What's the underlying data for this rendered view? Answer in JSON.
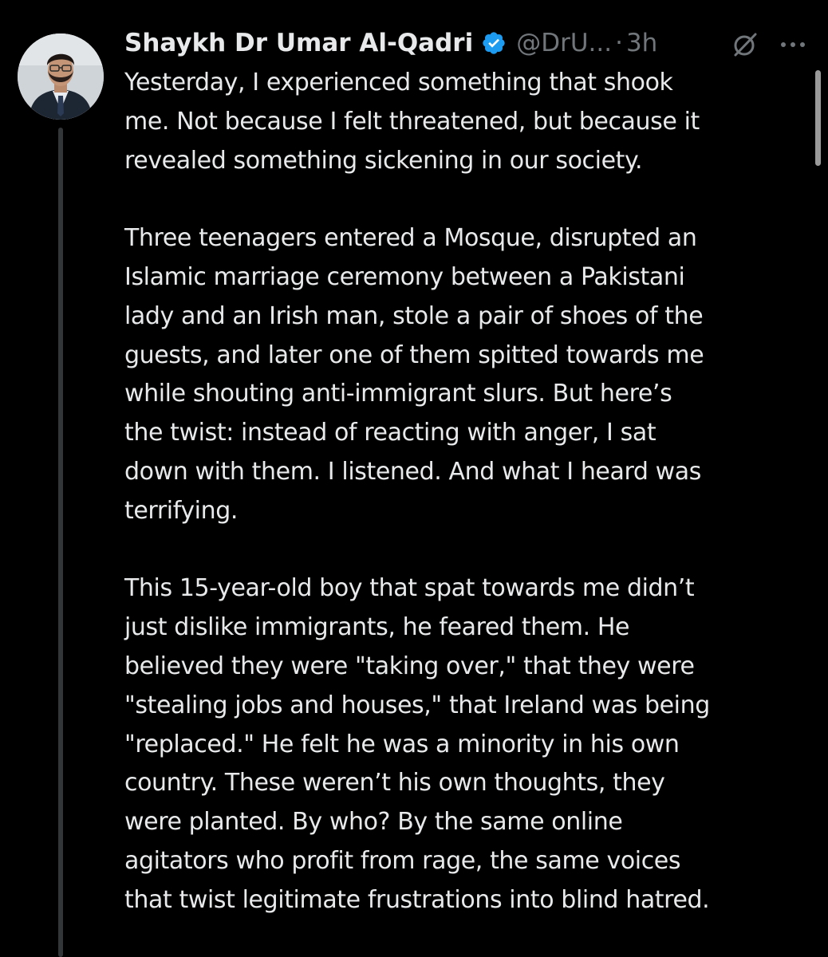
{
  "author": {
    "display_name": "Shaykh Dr Umar Al-Qadri",
    "handle": "@DrU...",
    "separator": "·",
    "time": "3h"
  },
  "icons": {
    "verified": "verified-badge-icon",
    "grok": "grok-icon",
    "more": "more-options-icon"
  },
  "colors": {
    "background": "#000000",
    "text": "#e7e9ea",
    "secondary_text": "#71767b",
    "verified_blue": "#1d9bf0"
  },
  "post": {
    "p1": [
      "Yesterday, I experienced something that shook",
      "me. Not because I felt threatened, but because it",
      "revealed something sickening in our society."
    ],
    "p2": [
      "Three teenagers entered a Mosque, disrupted an",
      "Islamic marriage ceremony between a Pakistani",
      "lady and an Irish man, stole a pair of shoes of the",
      "guests, and later one of them spitted towards me",
      "while shouting anti-immigrant slurs. But here’s",
      "the twist: instead of reacting with anger, I sat",
      "down with them. I listened. And what I heard was",
      "terrifying."
    ],
    "p3": [
      "This 15-year-old boy that spat towards me didn’t",
      "just dislike immigrants, he feared them. He",
      "believed they were \"taking over,\" that they were",
      "\"stealing jobs and houses,\" that Ireland was being",
      "\"replaced.\" He felt he was a minority in his own",
      "country. These weren’t his own thoughts, they",
      "were planted. By who? By the same online",
      "agitators who profit from rage, the same voices",
      "that twist legitimate frustrations into blind hatred."
    ]
  }
}
